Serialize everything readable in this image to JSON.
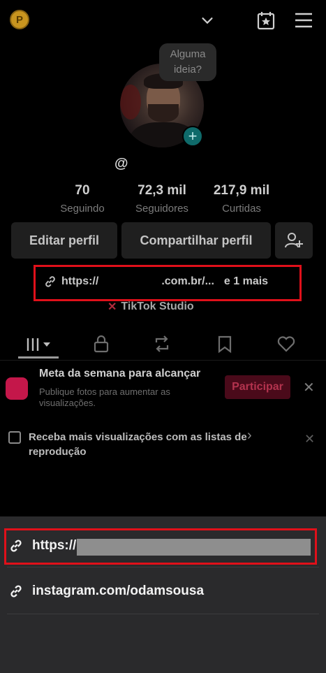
{
  "topbar": {
    "coin_letter": "P"
  },
  "profile": {
    "bubble_text": "Alguma ideia?",
    "handle": "@",
    "stats": [
      {
        "value": "70",
        "label": "Seguindo"
      },
      {
        "value": "72,3 mil",
        "label": "Seguidores"
      },
      {
        "value": "217,9 mil",
        "label": "Curtidas"
      }
    ],
    "edit_button": "Editar perfil",
    "share_button": "Compartilhar perfil",
    "link_prefix": "https://",
    "link_suffix": ".com.br/...",
    "link_more": "e 1 mais",
    "studio_label": "TikTok Studio"
  },
  "banner": {
    "title": "Meta da semana para alcançar",
    "subtitle": "Publique fotos para aumentar as visualizações.",
    "button": "Participar",
    "close": "✕"
  },
  "playlist_tip": {
    "text": "Receba mais visualizações com as listas de reprodução",
    "arrow": "›",
    "close": "✕"
  },
  "sheet": {
    "links": [
      {
        "text": "https://"
      },
      {
        "text": "instagram.com/odamsousa"
      }
    ]
  },
  "colors": {
    "highlight": "#e0101a",
    "sheet_bg": "#2a2a2c",
    "accent_pink": "#c4174a"
  }
}
